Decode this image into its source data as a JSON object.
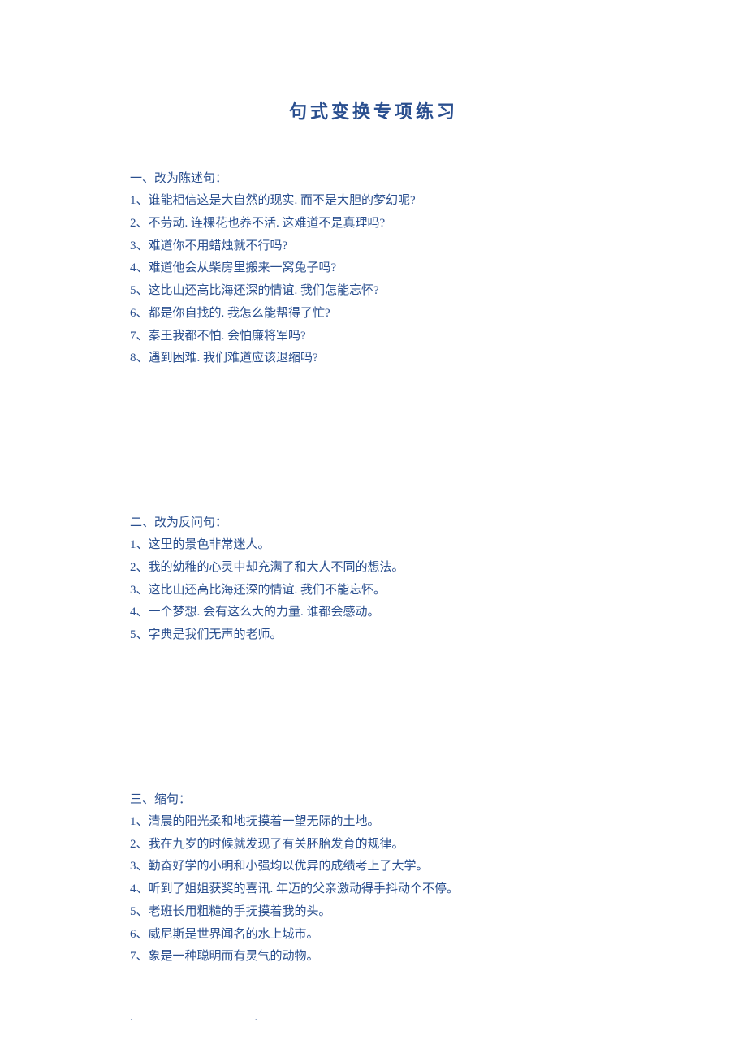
{
  "title": "句式变换专项练习",
  "sections": [
    {
      "heading": "一、改为陈述句：",
      "items": [
        "1、谁能相信这是大自然的现实. 而不是大胆的梦幻呢?",
        "2、不劳动. 连棵花也养不活. 这难道不是真理吗?",
        "3、难道你不用蜡烛就不行吗?",
        "4、难道他会从柴房里搬来一窝兔子吗?",
        "5、这比山还高比海还深的情谊. 我们怎能忘怀?",
        "6、都是你自找的. 我怎么能帮得了忙?",
        "7、秦王我都不怕. 会怕廉将军吗?",
        "8、遇到困难. 我们难道应该退缩吗?"
      ]
    },
    {
      "heading": "二、改为反问句：",
      "items": [
        "1、这里的景色非常迷人。",
        "2、我的幼稚的心灵中却充满了和大人不同的想法。",
        "3、这比山还高比海还深的情谊. 我们不能忘怀。",
        "4、一个梦想. 会有这么大的力量. 谁都会感动。",
        "5、字典是我们无声的老师。"
      ]
    },
    {
      "heading": "三、缩句：",
      "items": [
        "1、清晨的阳光柔和地抚摸着一望无际的土地。",
        "2、我在九岁的时候就发现了有关胚胎发育的规律。",
        "3、勤奋好学的小明和小强均以优异的成绩考上了大学。",
        "4、听到了姐姐获奖的喜讯. 年迈的父亲激动得手抖动个不停。",
        "5、老班长用粗糙的手抚摸着我的头。",
        "6、威尼斯是世界闻名的水上城市。",
        "7、象是一种聪明而有灵气的动物。"
      ]
    }
  ],
  "footer": {
    "dot1": ".",
    "dot2": "."
  }
}
